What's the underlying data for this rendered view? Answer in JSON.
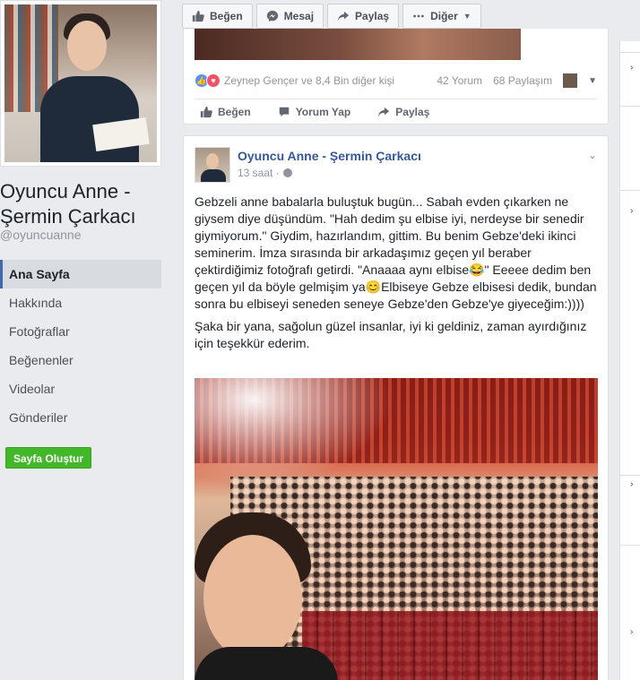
{
  "sidebar": {
    "page_name": "Oyuncu Anne - Şermin Çarkacı",
    "handle": "@oyuncuanne",
    "nav": [
      {
        "label": "Ana Sayfa",
        "active": true
      },
      {
        "label": "Hakkında",
        "active": false
      },
      {
        "label": "Fotoğraflar",
        "active": false
      },
      {
        "label": "Beğenenler",
        "active": false
      },
      {
        "label": "Videolar",
        "active": false
      },
      {
        "label": "Gönderiler",
        "active": false
      }
    ],
    "create_page_label": "Sayfa Oluştur"
  },
  "topbar": {
    "like": "Beğen",
    "message": "Mesaj",
    "share": "Paylaş",
    "more": "Diğer"
  },
  "post1": {
    "reactions_text": "Zeynep Gençer ve 8,4 Bin diğer kişi",
    "comments": "42 Yorum",
    "shares": "68 Paylaşım",
    "actions": {
      "like": "Beğen",
      "comment": "Yorum Yap",
      "share": "Paylaş"
    }
  },
  "post2": {
    "author": "Oyuncu Anne - Şermin Çarkacı",
    "time": "13 saat ·",
    "paragraph1": "Gebzeli anne babalarla buluştuk bugün... Sabah evden çıkarken ne giysem diye düşündüm. \"Hah dedim şu elbise iyi, nerdeyse bir senedir giymiyorum.\" Giydim, hazırlandım, gittim. Bu benim Gebze'deki ikinci seminerim. İmza sırasında bir arkadaşımız geçen yıl beraber çektirdiğimiz fotoğrafı getirdi. \"Anaaaa aynı elbise😂\" Eeeee dedim ben geçen yıl da böyle gelmişim ya😊Elbiseye Gebze elbisesi dedik, bundan sonra bu elbiseyi seneden seneye Gebze'den Gebze'ye giyeceğim:))))",
    "paragraph2": "Şaka bir yana, sağolun güzel insanlar, iyi ki geldiniz, zaman ayırdığınız için teşekkür ederim."
  },
  "colors": {
    "link": "#365899",
    "accent": "#4267b2",
    "create_button": "#42b72a",
    "background": "#e9ebee"
  },
  "icons": {
    "like": "thumbs-up-icon",
    "message": "messenger-icon",
    "share": "share-arrow-icon",
    "more": "ellipsis-icon",
    "comment": "comment-bubble-icon",
    "globe": "globe-icon"
  }
}
